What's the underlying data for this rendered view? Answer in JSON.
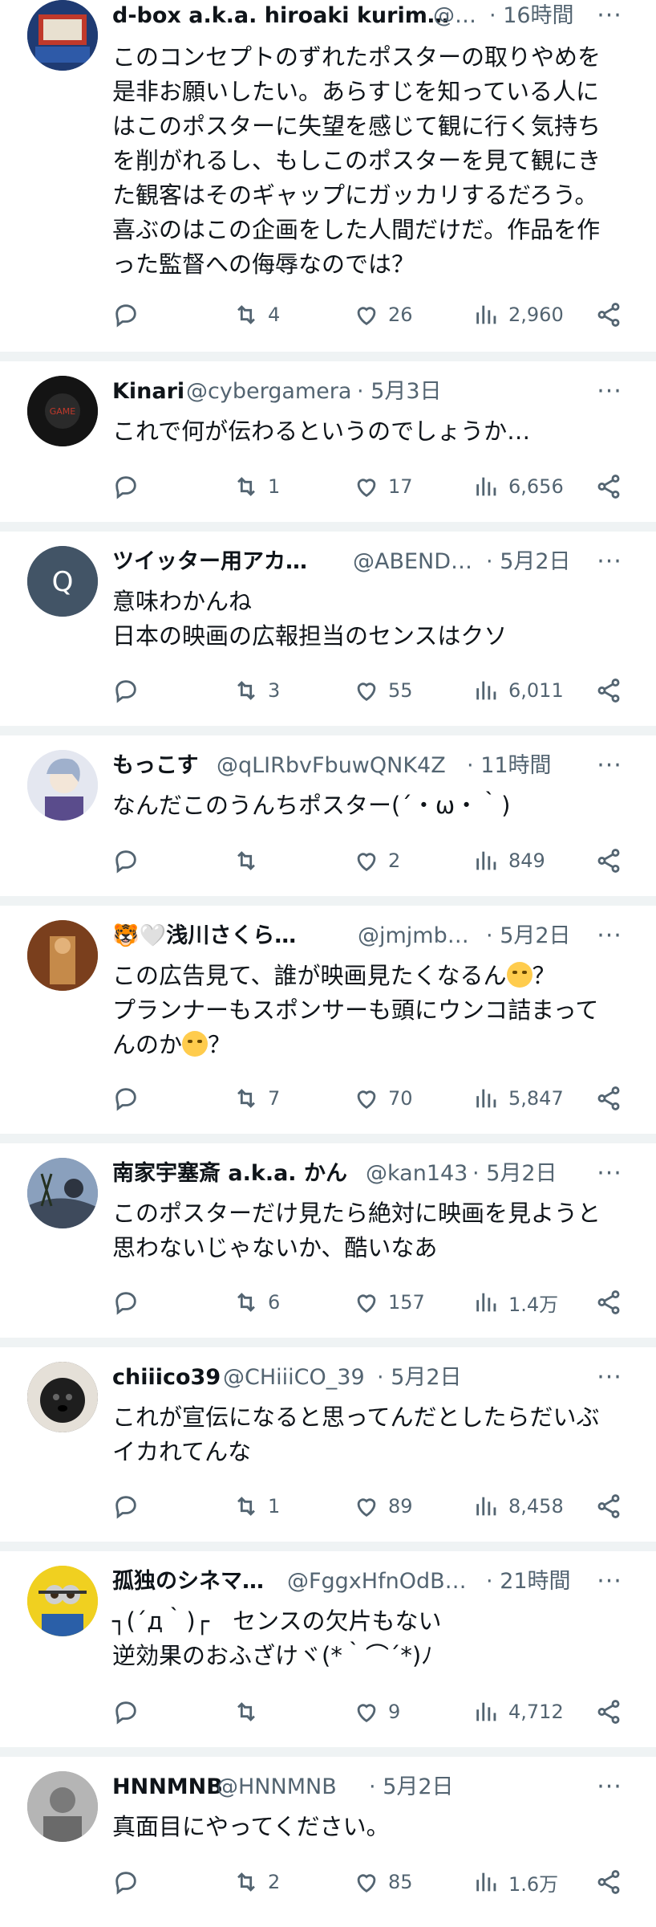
{
  "tweets": [
    {
      "name": "d-box a.k.a. hiroaki kurim…",
      "handle": "@…",
      "time": "16時間",
      "lines": [
        "このコンセプトのずれたポスターの取りやめを",
        "是非お願いしたい。あらすじを知っている人に",
        "はこのポスターに失望を感じて観に行く気持ち",
        "を削がれるし、もしこのポスターを見て観にき",
        "た観客はそのギャップにガッカリするだろう。",
        "喜ぶのはこの企画をした人間だけだ。作品を作",
        "った監督への侮辱なのでは？"
      ],
      "retweets": "4",
      "likes": "26",
      "views": "2,960",
      "avatar_color": "#c0392b"
    },
    {
      "name": "Kinari",
      "handle": "@cybergamera",
      "time": "5月3日",
      "lines": [
        "これで何が伝わるというのでしょうか…"
      ],
      "retweets": "1",
      "likes": "17",
      "views": "6,656",
      "avatar_color": "#1a1a1a"
    },
    {
      "name": "ツイッター用アカ…",
      "handle": "@ABEND…",
      "time": "5月2日",
      "avatar_letter": "Q",
      "lines": [
        "意味わかんね",
        "日本の映画の広報担当のセンスはクソ"
      ],
      "retweets": "3",
      "likes": "55",
      "views": "6,011",
      "avatar_color": "#425466"
    },
    {
      "name": "もっこす",
      "handle": "@qLIRbvFbuwQNK4Z",
      "time": "11時間",
      "lines": [
        "なんだこのうんちポスター(´・ω・｀)"
      ],
      "retweets": "",
      "likes": "2",
      "views": "849",
      "avatar_color": "#8e9bb5"
    },
    {
      "name": "🐯🤍浅川さくら…",
      "handle": "@jmjmb…",
      "time": "5月2日",
      "lines": [
        "この広告見て、誰が映画見たくなるん",
        "プランナーもスポンサーも頭にウンコ詰まって",
        "んのか"
      ],
      "retweets": "7",
      "likes": "70",
      "views": "5,847",
      "avatar_color": "#a0522d"
    },
    {
      "name": "南家宇塞斎 a.k.a. かん",
      "handle": "@kan143",
      "time": "5月2日",
      "lines": [
        "このポスターだけ見たら絶対に映画を見ようと",
        "思わないじゃないか、酷いなあ"
      ],
      "retweets": "6",
      "likes": "157",
      "views": "1.4万",
      "avatar_color": "#6b7f99"
    },
    {
      "name": "chiiico39",
      "handle": "@CHiiiCO_39",
      "time": "5月2日",
      "lines": [
        "これが宣伝になると思ってんだとしたらだいぶ",
        "イカれてんな"
      ],
      "retweets": "1",
      "likes": "89",
      "views": "8,458",
      "avatar_color": "#3a3a3a"
    },
    {
      "name": "孤独のシネマ…",
      "handle": "@FggxHfnOdB…",
      "time": "21時間",
      "lines": [
        "┐(´д｀)┌　センスの欠片もない",
        "逆効果のおふざけヾ(*｀⌒´*)ﾉ"
      ],
      "retweets": "",
      "likes": "9",
      "views": "4,712",
      "avatar_color": "#e6c200"
    },
    {
      "name": "HNNMNB",
      "handle": "@HNNMNB",
      "time": "5月2日",
      "lines": [
        "真面目にやってください。"
      ],
      "retweets": "2",
      "likes": "85",
      "views": "1.6万",
      "avatar_color": "#9a9a9a"
    }
  ],
  "colors": {
    "text": "#0f1419",
    "muted": "#536471",
    "separator": "#eff3f4"
  },
  "icons": [
    "reply-icon",
    "retweet-icon",
    "like-icon",
    "views-icon",
    "share-icon",
    "more-icon"
  ]
}
